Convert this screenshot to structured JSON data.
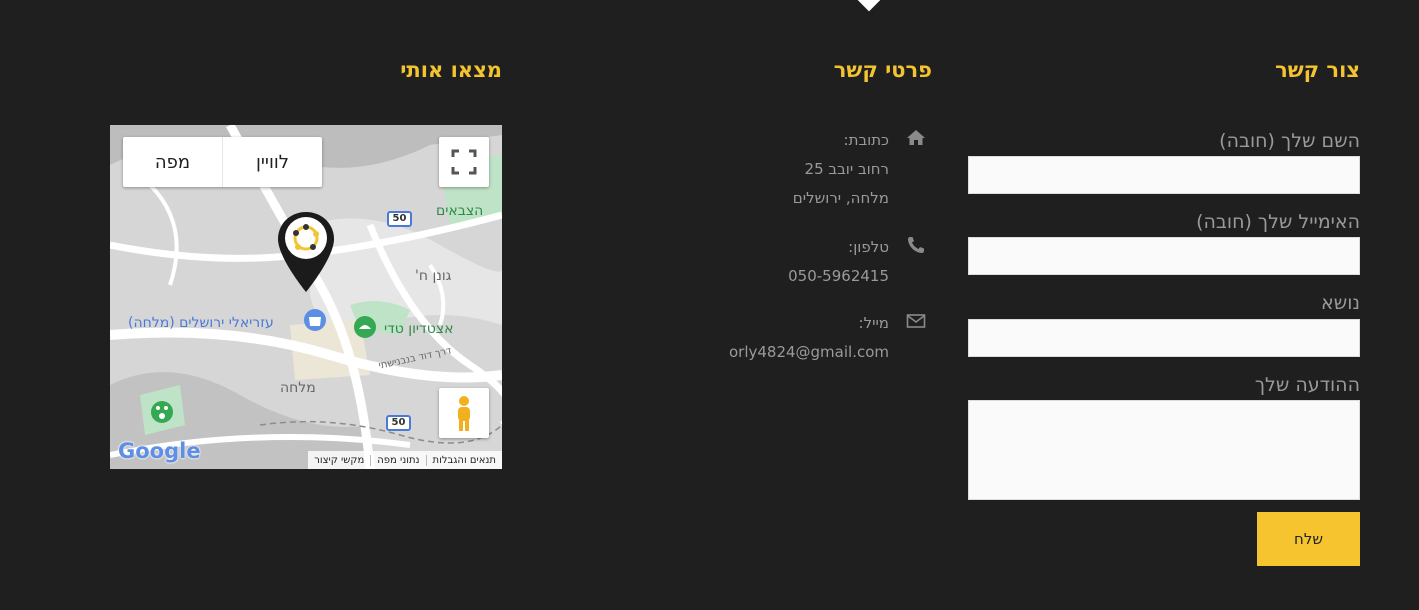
{
  "contact_form": {
    "heading": "צור קשר",
    "name_label": "השם שלך (חובה)",
    "email_label": "האימייל שלך (חובה)",
    "subject_label": "נושא",
    "message_label": "ההודעה שלך",
    "submit_label": "שלח"
  },
  "contact_details": {
    "heading": "פרטי קשר",
    "address": {
      "label": "כתובת:",
      "line1": "רחוב יובב 25",
      "line2": "מלחה, ירושלים"
    },
    "phone": {
      "label": "טלפון:",
      "value": "050-5962415"
    },
    "email": {
      "label": "מייל:",
      "value": "orly4824@gmail.com"
    }
  },
  "find_us": {
    "heading": "מצאו אותי",
    "map": {
      "type_map": "מפה",
      "type_satellite": "לוויין",
      "footer_terms": "תנאים והגבלות",
      "footer_data": "נתוני מפה",
      "footer_shortcuts": "מקשי קיצור",
      "google_logo": "Google",
      "route_badge_1": "50",
      "route_badge_2": "50",
      "label_mall": "עזריאלי ירושלים (מלחה)",
      "label_stadium": "אצטדיון טדי",
      "label_malha": "מלחה",
      "label_ganon": "גונן ח'",
      "label_tzvaim": "הצבאים",
      "label_road": "דרך דוד בנבנישתי"
    }
  },
  "colors": {
    "accent": "#f5c42f",
    "background": "#1f1f1f",
    "text": "#9a9a9a"
  }
}
